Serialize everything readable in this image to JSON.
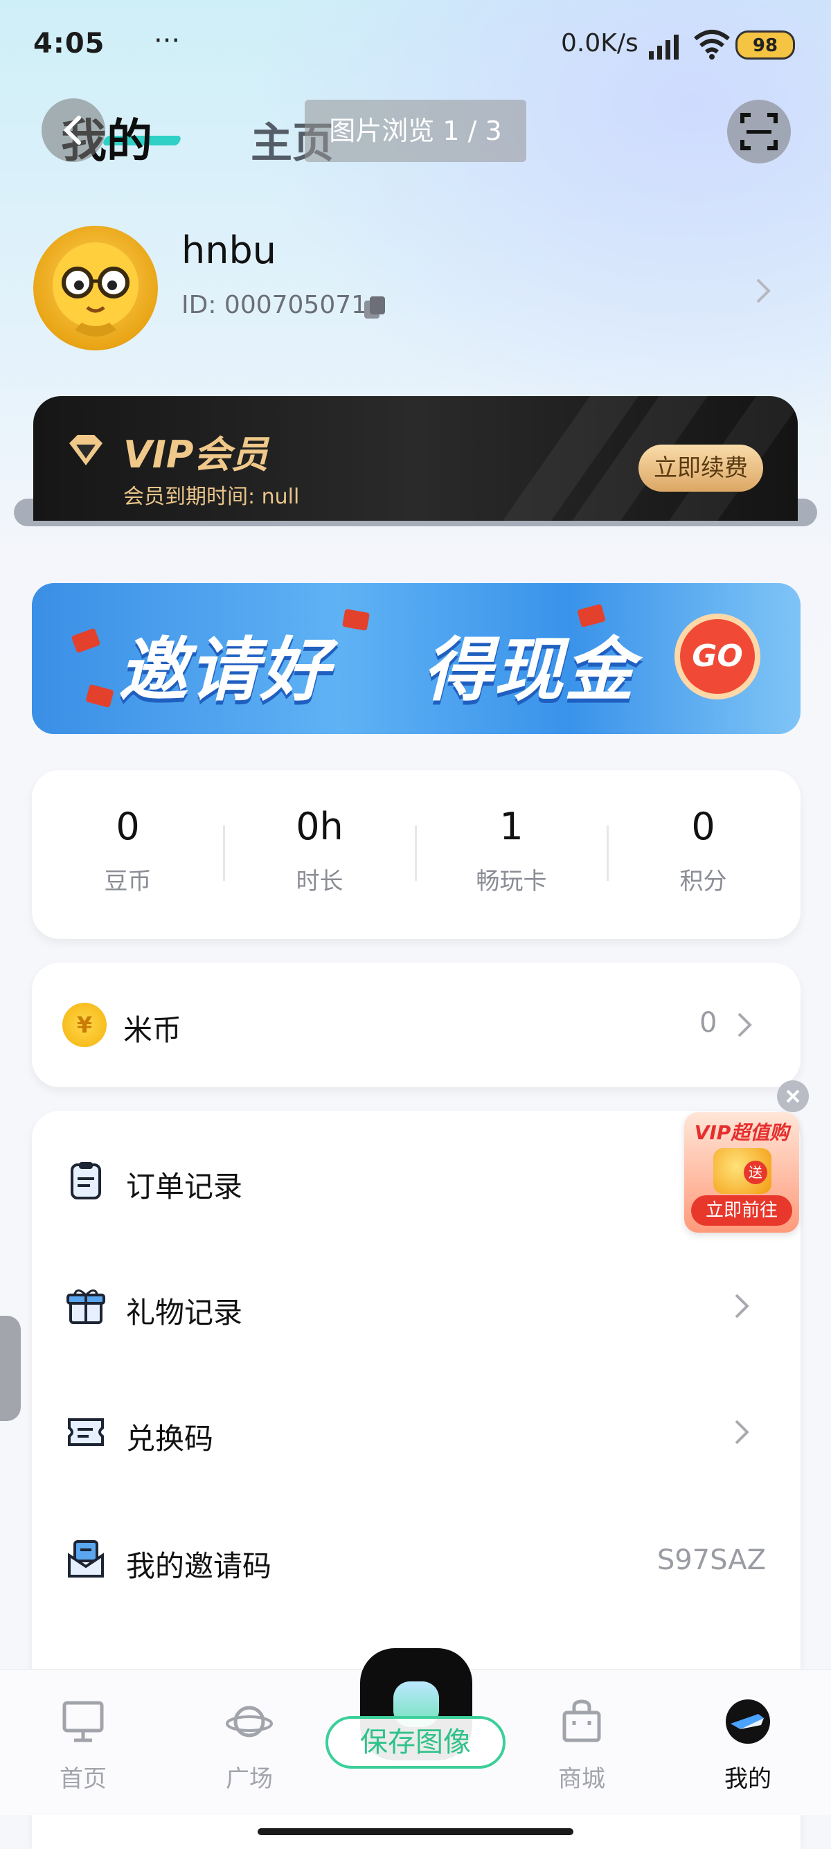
{
  "status_bar": {
    "time": "4:05",
    "dots": "···",
    "net_speed": "0.0K/s",
    "battery": "98"
  },
  "header": {
    "title_mine": "我的",
    "title_home": "主页",
    "viewer_label": "图片浏览 1 / 3"
  },
  "profile": {
    "username": "hnbu",
    "user_id": "ID: 000705071"
  },
  "vip": {
    "title": "VIP会员",
    "expire_text": "会员到期时间: null",
    "renew_label": "立即续费"
  },
  "banner": {
    "text_left": "邀请好",
    "text_right": "得现金",
    "go_label": "GO"
  },
  "stats": [
    {
      "value": "0",
      "label": "豆币"
    },
    {
      "value": "0h",
      "label": "时长"
    },
    {
      "value": "1",
      "label": "畅玩卡"
    },
    {
      "value": "0",
      "label": "积分"
    }
  ],
  "coins": {
    "icon_text": "¥",
    "label": "米币",
    "value": "0"
  },
  "menu": [
    {
      "label": "订单记录",
      "icon": "clipboard-icon"
    },
    {
      "label": "礼物记录",
      "icon": "gift-icon"
    },
    {
      "label": "兑换码",
      "icon": "ticket-icon"
    },
    {
      "label": "我的邀请码",
      "icon": "mail-icon",
      "value": "S97SAZ"
    }
  ],
  "promo": {
    "title": "VIP超值购",
    "gift_text": "送",
    "button": "立即前往"
  },
  "tabbar": {
    "items": [
      {
        "label": "首页",
        "icon": "monitor-icon"
      },
      {
        "label": "广场",
        "icon": "planet-icon"
      },
      {
        "label": "商城",
        "icon": "bag-icon"
      },
      {
        "label": "我的",
        "icon": "profile-icon",
        "active": true
      }
    ],
    "save_image": "保存图像"
  },
  "colors": {
    "accent": "#3ccf9a",
    "vip_gold": "#f0c98a",
    "banner_blue": "#3a8fe6",
    "promo_red": "#e8372b"
  }
}
